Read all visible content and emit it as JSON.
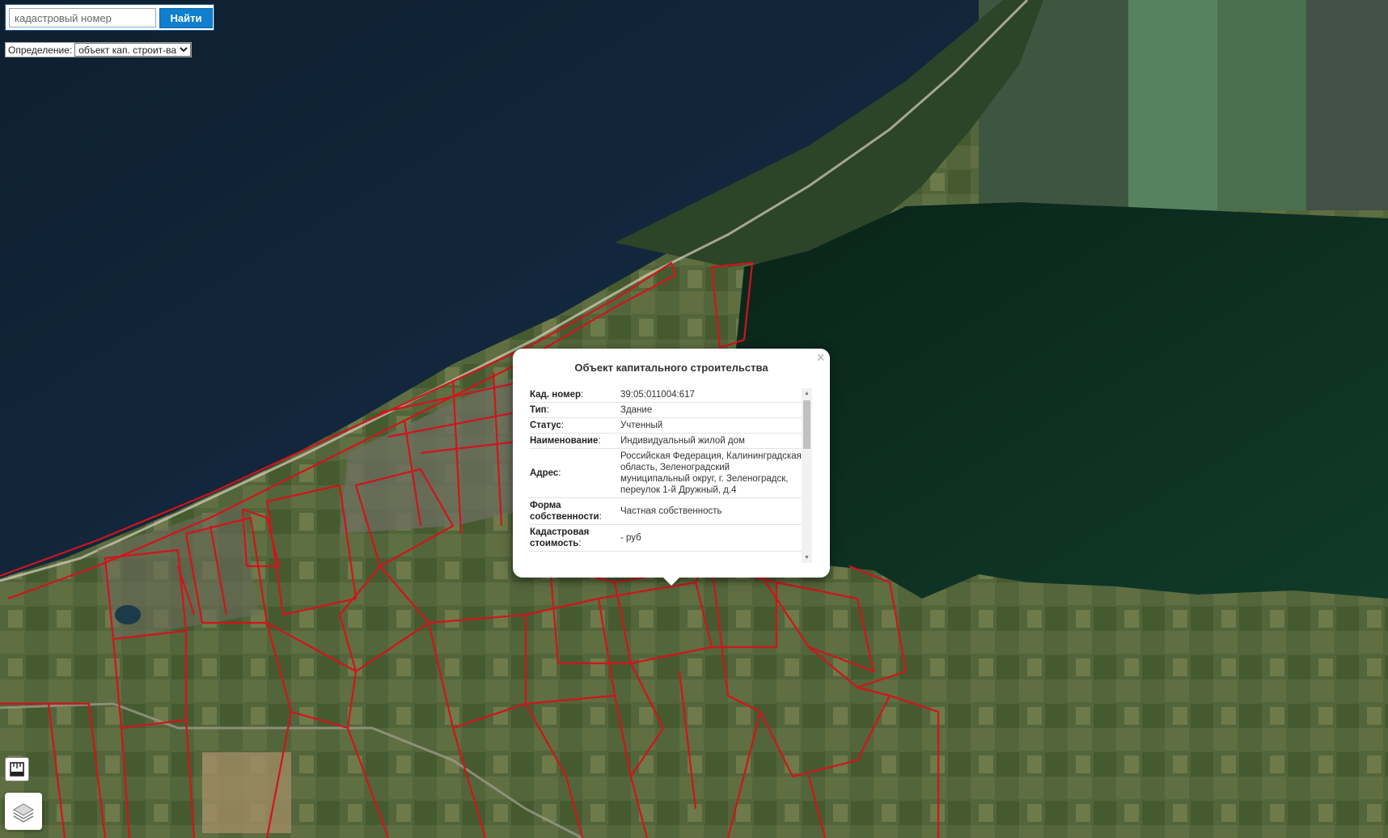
{
  "search": {
    "placeholder": "кадастровый номер",
    "button_label": "Найти"
  },
  "definition": {
    "label": "Определение:",
    "selected": "объект кап. строит-ва"
  },
  "popup": {
    "title": "Объект капитального строительства",
    "close_label": "×",
    "rows": [
      {
        "key": "Кад. номер",
        "value": "39:05:011004:617"
      },
      {
        "key": "Тип",
        "value": "Здание"
      },
      {
        "key": "Статус",
        "value": "Учтенный"
      },
      {
        "key": "Наименование",
        "value": "Индивидуальный жилой дом"
      },
      {
        "key": "Адрес",
        "value": "Российская Федерация, Калининградская область, Зеленоградский муниципальный округ, г. Зеленоградск, переулок 1-й Дружный, д.4"
      },
      {
        "key": "Форма собственности",
        "value": "Частная собственность"
      },
      {
        "key": "Кадастровая стоимость",
        "value": "- руб"
      }
    ]
  },
  "controls": {
    "ruler_icon": "ruler-icon",
    "layers_icon": "layers-icon"
  },
  "colors": {
    "sea": "#13263a",
    "lagoon": "#0c2a1e",
    "land": "#4b5d33",
    "parcel_border": "#d1141c",
    "accent_button": "#0f7fce"
  }
}
